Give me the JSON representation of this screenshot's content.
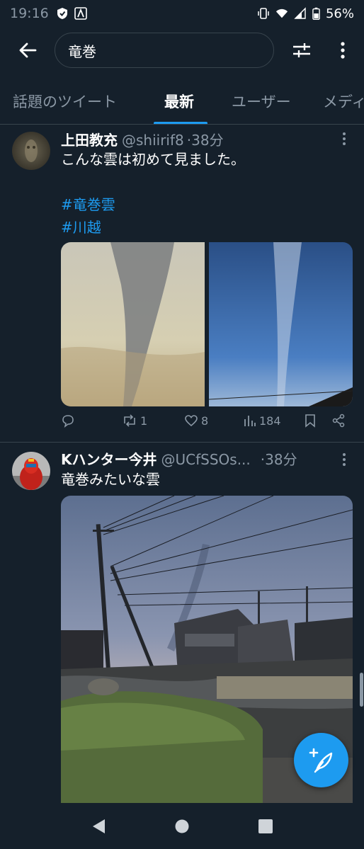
{
  "status_bar": {
    "time": "19:16",
    "battery": "56%"
  },
  "search": {
    "query": "竜巻"
  },
  "tabs": [
    {
      "label": "話題のツイート"
    },
    {
      "label": "最新"
    },
    {
      "label": "ユーザー"
    },
    {
      "label": "メディ"
    }
  ],
  "tweets": [
    {
      "name": "上田教充",
      "handle": "@shiirif8",
      "separator": "·",
      "time": "38分",
      "text": "こんな雲は初めて見ました。",
      "hashtags": [
        "#竜巻雲",
        "#川越"
      ],
      "retweets": "1",
      "likes": "8",
      "views": "184"
    },
    {
      "name": "Kハンター今井",
      "handle": "@UCfSSOs...",
      "separator": "·",
      "time": "38分",
      "text": "竜巻みたいな雲"
    }
  ],
  "icons": {
    "back": "arrow-left-icon",
    "filter": "sliders-icon",
    "more": "vertical-dots-icon",
    "reply": "speech-bubble-icon",
    "retweet": "retweet-icon",
    "like": "heart-icon",
    "views": "bar-chart-icon",
    "bookmark": "bookmark-icon",
    "share": "share-icon",
    "compose": "feather-plus-icon"
  },
  "colors": {
    "background": "#15202b",
    "accent": "#1d9bf0",
    "muted": "#8b98a5",
    "border": "#38444d"
  }
}
